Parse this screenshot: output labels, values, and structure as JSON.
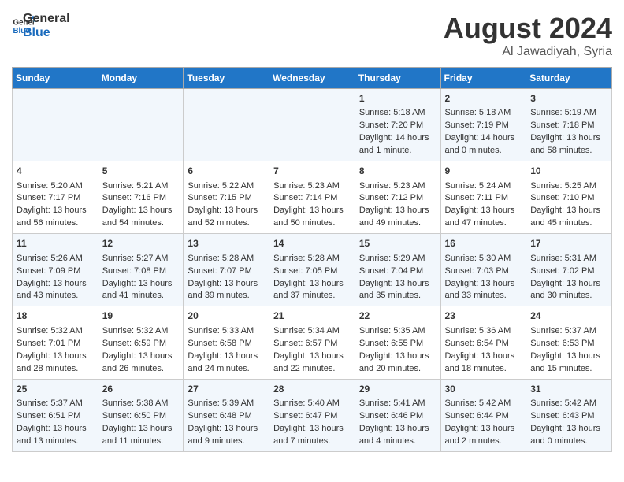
{
  "header": {
    "logo_general": "General",
    "logo_blue": "Blue",
    "month_year": "August 2024",
    "location": "Al Jawadiyah, Syria"
  },
  "weekdays": [
    "Sunday",
    "Monday",
    "Tuesday",
    "Wednesday",
    "Thursday",
    "Friday",
    "Saturday"
  ],
  "weeks": [
    [
      {
        "day": "",
        "text": ""
      },
      {
        "day": "",
        "text": ""
      },
      {
        "day": "",
        "text": ""
      },
      {
        "day": "",
        "text": ""
      },
      {
        "day": "1",
        "text": "Sunrise: 5:18 AM\nSunset: 7:20 PM\nDaylight: 14 hours\nand 1 minute."
      },
      {
        "day": "2",
        "text": "Sunrise: 5:18 AM\nSunset: 7:19 PM\nDaylight: 14 hours\nand 0 minutes."
      },
      {
        "day": "3",
        "text": "Sunrise: 5:19 AM\nSunset: 7:18 PM\nDaylight: 13 hours\nand 58 minutes."
      }
    ],
    [
      {
        "day": "4",
        "text": "Sunrise: 5:20 AM\nSunset: 7:17 PM\nDaylight: 13 hours\nand 56 minutes."
      },
      {
        "day": "5",
        "text": "Sunrise: 5:21 AM\nSunset: 7:16 PM\nDaylight: 13 hours\nand 54 minutes."
      },
      {
        "day": "6",
        "text": "Sunrise: 5:22 AM\nSunset: 7:15 PM\nDaylight: 13 hours\nand 52 minutes."
      },
      {
        "day": "7",
        "text": "Sunrise: 5:23 AM\nSunset: 7:14 PM\nDaylight: 13 hours\nand 50 minutes."
      },
      {
        "day": "8",
        "text": "Sunrise: 5:23 AM\nSunset: 7:12 PM\nDaylight: 13 hours\nand 49 minutes."
      },
      {
        "day": "9",
        "text": "Sunrise: 5:24 AM\nSunset: 7:11 PM\nDaylight: 13 hours\nand 47 minutes."
      },
      {
        "day": "10",
        "text": "Sunrise: 5:25 AM\nSunset: 7:10 PM\nDaylight: 13 hours\nand 45 minutes."
      }
    ],
    [
      {
        "day": "11",
        "text": "Sunrise: 5:26 AM\nSunset: 7:09 PM\nDaylight: 13 hours\nand 43 minutes."
      },
      {
        "day": "12",
        "text": "Sunrise: 5:27 AM\nSunset: 7:08 PM\nDaylight: 13 hours\nand 41 minutes."
      },
      {
        "day": "13",
        "text": "Sunrise: 5:28 AM\nSunset: 7:07 PM\nDaylight: 13 hours\nand 39 minutes."
      },
      {
        "day": "14",
        "text": "Sunrise: 5:28 AM\nSunset: 7:05 PM\nDaylight: 13 hours\nand 37 minutes."
      },
      {
        "day": "15",
        "text": "Sunrise: 5:29 AM\nSunset: 7:04 PM\nDaylight: 13 hours\nand 35 minutes."
      },
      {
        "day": "16",
        "text": "Sunrise: 5:30 AM\nSunset: 7:03 PM\nDaylight: 13 hours\nand 33 minutes."
      },
      {
        "day": "17",
        "text": "Sunrise: 5:31 AM\nSunset: 7:02 PM\nDaylight: 13 hours\nand 30 minutes."
      }
    ],
    [
      {
        "day": "18",
        "text": "Sunrise: 5:32 AM\nSunset: 7:01 PM\nDaylight: 13 hours\nand 28 minutes."
      },
      {
        "day": "19",
        "text": "Sunrise: 5:32 AM\nSunset: 6:59 PM\nDaylight: 13 hours\nand 26 minutes."
      },
      {
        "day": "20",
        "text": "Sunrise: 5:33 AM\nSunset: 6:58 PM\nDaylight: 13 hours\nand 24 minutes."
      },
      {
        "day": "21",
        "text": "Sunrise: 5:34 AM\nSunset: 6:57 PM\nDaylight: 13 hours\nand 22 minutes."
      },
      {
        "day": "22",
        "text": "Sunrise: 5:35 AM\nSunset: 6:55 PM\nDaylight: 13 hours\nand 20 minutes."
      },
      {
        "day": "23",
        "text": "Sunrise: 5:36 AM\nSunset: 6:54 PM\nDaylight: 13 hours\nand 18 minutes."
      },
      {
        "day": "24",
        "text": "Sunrise: 5:37 AM\nSunset: 6:53 PM\nDaylight: 13 hours\nand 15 minutes."
      }
    ],
    [
      {
        "day": "25",
        "text": "Sunrise: 5:37 AM\nSunset: 6:51 PM\nDaylight: 13 hours\nand 13 minutes."
      },
      {
        "day": "26",
        "text": "Sunrise: 5:38 AM\nSunset: 6:50 PM\nDaylight: 13 hours\nand 11 minutes."
      },
      {
        "day": "27",
        "text": "Sunrise: 5:39 AM\nSunset: 6:48 PM\nDaylight: 13 hours\nand 9 minutes."
      },
      {
        "day": "28",
        "text": "Sunrise: 5:40 AM\nSunset: 6:47 PM\nDaylight: 13 hours\nand 7 minutes."
      },
      {
        "day": "29",
        "text": "Sunrise: 5:41 AM\nSunset: 6:46 PM\nDaylight: 13 hours\nand 4 minutes."
      },
      {
        "day": "30",
        "text": "Sunrise: 5:42 AM\nSunset: 6:44 PM\nDaylight: 13 hours\nand 2 minutes."
      },
      {
        "day": "31",
        "text": "Sunrise: 5:42 AM\nSunset: 6:43 PM\nDaylight: 13 hours\nand 0 minutes."
      }
    ]
  ]
}
